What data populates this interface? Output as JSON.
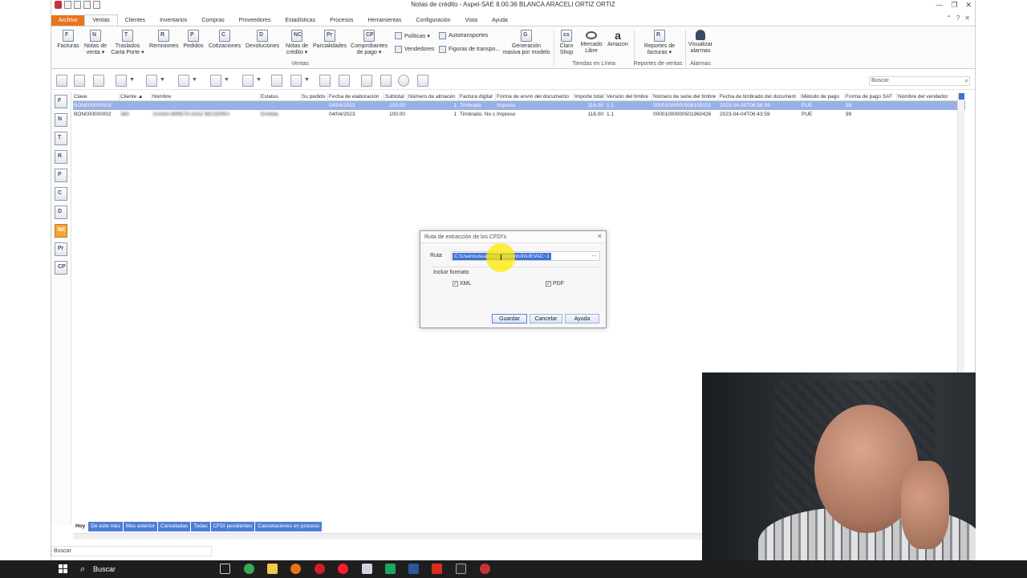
{
  "window": {
    "title": "Notas de crédito - Aspel-SAE 8.00.36  BLANCA ARACELI ORTIZ ORTIZ",
    "controls": [
      "—",
      "❐",
      "✕"
    ]
  },
  "menu": {
    "tabs": [
      "Archivo",
      "Ventas",
      "Clientes",
      "Inventarios",
      "Compras",
      "Proveedores",
      "Estadísticas",
      "Procesos",
      "Herramientas",
      "Configuración",
      "Vista",
      "Ayuda"
    ]
  },
  "ribbon": {
    "facturas": "Facturas",
    "notas_venta": "Notas de venta ▾",
    "traslados": "Traslados Carta Porte ▾",
    "remisiones": "Remisiones",
    "pedidos": "Pedidos",
    "cotizaciones": "Cotizaciones",
    "devoluciones": "Devoluciones",
    "notas_credito": "Notas de crédito ▾",
    "parcialidades": "Parcialidades",
    "comprobantes_pago": "Comprobantes de pago ▾",
    "politicas": "Políticas ▾",
    "vendedores": "Vendedores",
    "autotransportes": "Autotransportes",
    "figuras": "Figuras de transpo...",
    "generacion": "Generación masiva por modelo",
    "group_ventas": "Ventas",
    "claro_shop": "Claro Shop",
    "mercado_libre": "Mercado Libre",
    "amazon": "Amazon",
    "group_tiendas": "Tiendas en Línea",
    "reportes_facturas": "Reportes de facturas ▾",
    "group_reportes": "Reportes de ventas",
    "visualizar_alarmas": "Visualizar alarmas",
    "group_alarmas": "Alarmas"
  },
  "toolbar": {
    "search_placeholder": "Buscar"
  },
  "sidebar": [
    "F",
    "N",
    "T",
    "R",
    "P",
    "C",
    "D",
    "NC",
    "Pr",
    "CP"
  ],
  "grid": {
    "columns": [
      "Clave",
      "Cliente ▲",
      "Nombre",
      "Estatus",
      "Su pedido",
      "Fecha de elaboración",
      "Subtotal",
      "Número de almacén",
      "Factura digital",
      "Forma de envío del documento",
      "Importe total",
      "Versión del timbre",
      "Número de serie del timbre",
      "Fecha de timbrado del document",
      "Método de pago",
      "Forma de pago SAT",
      "Nombre del vendedor"
    ],
    "rows": [
      [
        "BON000000003",
        "",
        "",
        "",
        "",
        "04/04/2023",
        "100.00",
        "1",
        "Timbrado",
        "Impreso",
        "116.00",
        "1.1",
        "00001000000506109151",
        "2023-04-04T06:56:34",
        "PUE",
        "99",
        ""
      ],
      [
        "BON000000002",
        "380",
        "JUANA MIRETA DIAZ BECERRA",
        "Emitida",
        "",
        "04/04/2023",
        "100.00",
        "1",
        "Timbrado. No c",
        "Impreso",
        "116.00",
        "1.1",
        "00001000000501960426",
        "2023-04-04T06:43:59",
        "PUE",
        "99",
        ""
      ]
    ]
  },
  "filters": [
    "Hoy",
    "De este mes",
    "Mes anterior",
    "Canceladas",
    "Todas",
    "CFDI pendientes",
    "Cancelaciones en proceso"
  ],
  "statusbar": {
    "search": "Buscar"
  },
  "dialog": {
    "title": "Ruta de extracción de los CFDI's",
    "ruta_label": "Ruta",
    "ruta_value": "C:\\Users\\usuario\\Documents\\NUEVAC~1",
    "browse": "...",
    "incluir_formato": "Incluir formato",
    "xml_label": "XML",
    "xml_checked": true,
    "pdf_label": "PDF",
    "pdf_checked": true,
    "guardar": "Guardar",
    "cancelar": "Cancelar",
    "ayuda": "Ayuda"
  },
  "taskbar": {
    "search": "Buscar"
  },
  "colors": {
    "file_tab": "#e8741e",
    "selection": "#97b0e6",
    "filter_tab": "#4d7ed9",
    "active_sidebar": "#f3a538"
  }
}
